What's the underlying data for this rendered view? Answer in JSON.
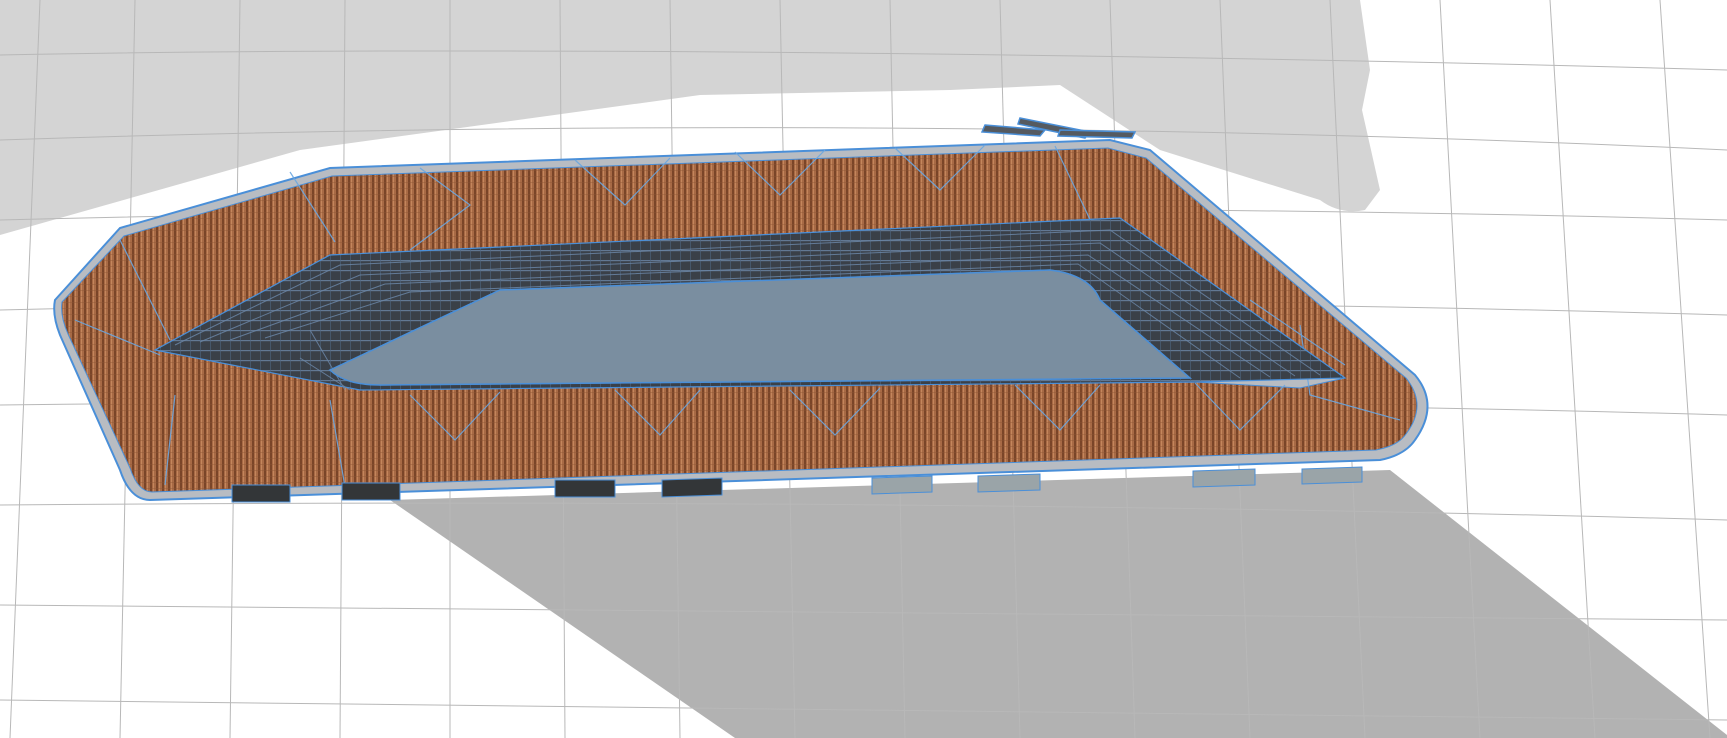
{
  "viewport": {
    "type": "3d-model-view",
    "view": "perspective-top",
    "object": "stadium-model",
    "render_style": "textured-with-wireframe-edges"
  },
  "colors": {
    "background": "#ffffff",
    "ground_plane": "#d4d4d4",
    "grid_line": "#b8b8b8",
    "shadow": "#b2b2b2",
    "roof_texture_base": "#a86a45",
    "roof_texture_dark": "#6e3e22",
    "roof_texture_light": "#c98a60",
    "concrete_rim": "#b8bcc2",
    "seating_tiers": "#3a4048",
    "pitch_surface": "#7a8ea0",
    "edge_highlight": "#4a8fd8",
    "opening_dark": "#333638",
    "opening_glass": "#9aa4a8"
  }
}
